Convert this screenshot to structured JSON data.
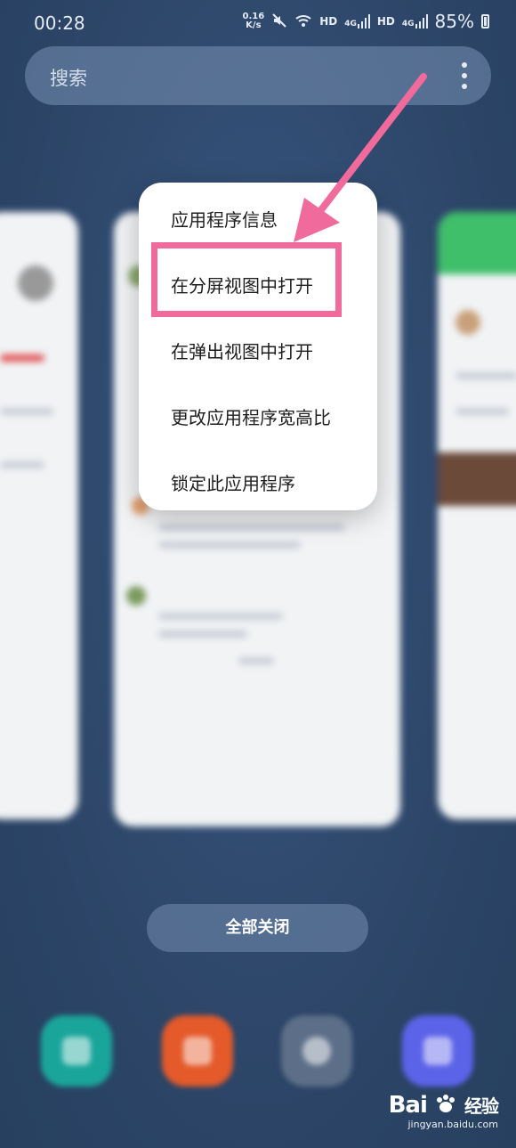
{
  "status_bar": {
    "time": "00:28",
    "netspeed_value": "0.16",
    "netspeed_unit": "K/s",
    "hd1": "HD",
    "sig1": "4G",
    "hd2": "HD",
    "sig2": "4G",
    "battery": "85%"
  },
  "search": {
    "placeholder": "搜索"
  },
  "menu": {
    "items": [
      {
        "label": "应用程序信息"
      },
      {
        "label": "在分屏视图中打开"
      },
      {
        "label": "在弹出视图中打开"
      },
      {
        "label": "更改应用程序宽高比"
      },
      {
        "label": "锁定此应用程序"
      }
    ]
  },
  "close_all_label": "全部关闭",
  "watermark": {
    "brand": "Bai",
    "brand_cn": "经验",
    "url": "jingyan.baidu.com"
  },
  "colors": {
    "highlight": "#f06a9c",
    "background": "#2f4a6e"
  }
}
